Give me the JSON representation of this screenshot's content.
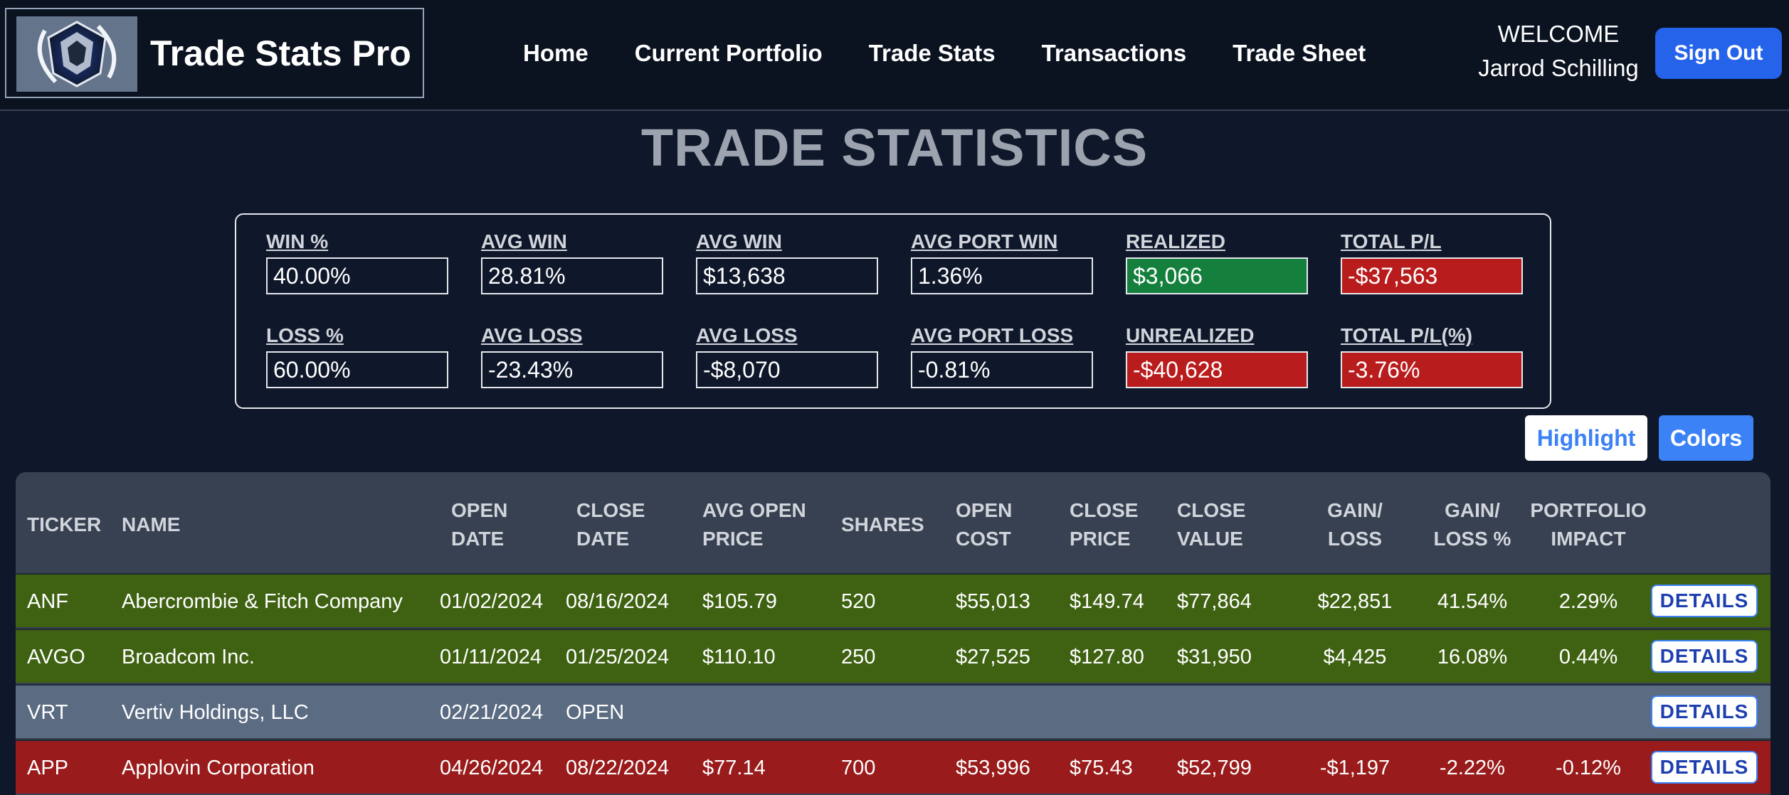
{
  "brand": {
    "name": "Trade Stats Pro",
    "logo_icon": "crystal-shield-logo-icon"
  },
  "nav": [
    "Home",
    "Current Portfolio",
    "Trade Stats",
    "Transactions",
    "Trade Sheet"
  ],
  "user": {
    "welcome": "WELCOME",
    "name": "Jarrod Schilling",
    "signout": "Sign Out"
  },
  "page_title": "TRADE STATISTICS",
  "stats": {
    "row1": [
      {
        "label": "WIN %",
        "value": "40.00%",
        "tone": ""
      },
      {
        "label": "AVG WIN",
        "value": "28.81%",
        "tone": ""
      },
      {
        "label": "AVG WIN",
        "value": "$13,638",
        "tone": ""
      },
      {
        "label": "AVG PORT WIN",
        "value": "1.36%",
        "tone": ""
      },
      {
        "label": "REALIZED",
        "value": "$3,066",
        "tone": "green"
      },
      {
        "label": "TOTAL P/L",
        "value": "-$37,563",
        "tone": "red"
      }
    ],
    "row2": [
      {
        "label": "LOSS %",
        "value": "60.00%",
        "tone": ""
      },
      {
        "label": "AVG LOSS",
        "value": "-23.43%",
        "tone": ""
      },
      {
        "label": "AVG LOSS",
        "value": "-$8,070",
        "tone": ""
      },
      {
        "label": "AVG PORT LOSS",
        "value": "-0.81%",
        "tone": ""
      },
      {
        "label": "UNREALIZED",
        "value": "-$40,628",
        "tone": "red"
      },
      {
        "label": "TOTAL P/L(%)",
        "value": "-3.76%",
        "tone": "red"
      }
    ]
  },
  "buttons": {
    "highlight": "Highlight",
    "colors": "Colors"
  },
  "colors": {
    "win_row": "#3f6212",
    "open_row": "#5b6b82",
    "loss_row": "#991b1b",
    "accent": "#2563eb"
  },
  "table": {
    "headers": [
      [
        "TICKER"
      ],
      [
        "NAME"
      ],
      [
        "OPEN",
        "DATE"
      ],
      [
        "CLOSE",
        "DATE"
      ],
      [
        "AVG OPEN",
        "PRICE"
      ],
      [
        "SHARES"
      ],
      [
        "OPEN",
        "COST"
      ],
      [
        "CLOSE",
        "PRICE"
      ],
      [
        "CLOSE",
        "VALUE"
      ],
      [
        "GAIN/",
        "LOSS"
      ],
      [
        "GAIN/",
        "LOSS %"
      ],
      [
        "PORTFOLIO",
        "IMPACT"
      ]
    ],
    "details_label": "DETAILS",
    "rows": [
      {
        "status": "win",
        "cells": [
          "ANF",
          "Abercrombie & Fitch Company",
          "01/02/2024",
          "08/16/2024",
          "$105.79",
          "520",
          "$55,013",
          "$149.74",
          "$77,864",
          "$22,851",
          "41.54%",
          "2.29%"
        ]
      },
      {
        "status": "win",
        "cells": [
          "AVGO",
          "Broadcom Inc.",
          "01/11/2024",
          "01/25/2024",
          "$110.10",
          "250",
          "$27,525",
          "$127.80",
          "$31,950",
          "$4,425",
          "16.08%",
          "0.44%"
        ]
      },
      {
        "status": "open",
        "cells": [
          "VRT",
          "Vertiv Holdings, LLC",
          "02/21/2024",
          "OPEN",
          "",
          "",
          "",
          "",
          "",
          "",
          "",
          ""
        ]
      },
      {
        "status": "loss",
        "cells": [
          "APP",
          "Applovin Corporation",
          "04/26/2024",
          "08/22/2024",
          "$77.14",
          "700",
          "$53,996",
          "$75.43",
          "$52,799",
          "-$1,197",
          "-2.22%",
          "-0.12%"
        ]
      }
    ]
  }
}
